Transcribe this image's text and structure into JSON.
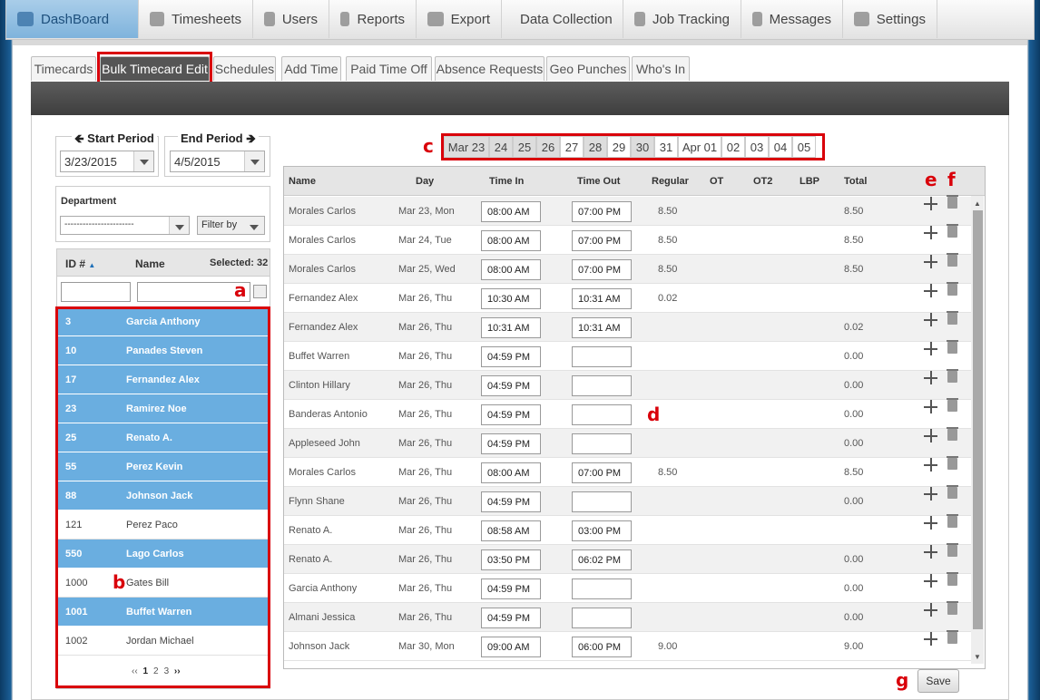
{
  "nav": {
    "items": [
      {
        "label": "DashBoard",
        "icon": "dashboard-gauge-icon",
        "active": true
      },
      {
        "label": "Timesheets",
        "icon": "calendar-icon",
        "active": false
      },
      {
        "label": "Users",
        "icon": "user-icon",
        "active": false
      },
      {
        "label": "Reports",
        "icon": "bar-chart-icon",
        "active": false
      },
      {
        "label": "Export",
        "icon": "export-arrow-icon",
        "active": false
      },
      {
        "label": "Data Collection",
        "icon": "data-collection-icon",
        "active": false
      },
      {
        "label": "Job Tracking",
        "icon": "job-tracking-icon",
        "active": false
      },
      {
        "label": "Messages",
        "icon": "chat-bubble-icon",
        "active": false
      },
      {
        "label": "Settings",
        "icon": "wrench-screwdriver-icon",
        "active": false
      }
    ]
  },
  "tabs": [
    "Timecards",
    "Bulk Timecard Edit",
    "Schedules",
    "Add Time",
    "Paid Time Off",
    "Absence Requests",
    "Geo Punches",
    "Who's In"
  ],
  "period": {
    "start_label": "Start Period",
    "start_value": "3/23/2015",
    "end_label": "End Period",
    "end_value": "4/5/2015"
  },
  "department": {
    "label": "Department",
    "value": "-----------------------",
    "filter_label": "Filter by"
  },
  "employee_list": {
    "headers": {
      "id": "ID #",
      "name": "Name",
      "selected": "Selected: 32"
    },
    "rows": [
      {
        "id": "3",
        "name": "Garcia Anthony",
        "selected": true
      },
      {
        "id": "10",
        "name": "Panades Steven",
        "selected": true
      },
      {
        "id": "17",
        "name": "Fernandez Alex",
        "selected": true
      },
      {
        "id": "23",
        "name": "Ramirez Noe",
        "selected": true
      },
      {
        "id": "25",
        "name": "Renato A.",
        "selected": true
      },
      {
        "id": "55",
        "name": "Perez Kevin",
        "selected": true
      },
      {
        "id": "88",
        "name": "Johnson Jack",
        "selected": true
      },
      {
        "id": "121",
        "name": "Perez Paco",
        "selected": false
      },
      {
        "id": "550",
        "name": "Lago Carlos",
        "selected": true
      },
      {
        "id": "1000",
        "name": "Gates Bill",
        "selected": false
      },
      {
        "id": "1001",
        "name": "Buffet Warren",
        "selected": true
      },
      {
        "id": "1002",
        "name": "Jordan Michael",
        "selected": false
      }
    ],
    "pager": {
      "prev": "‹‹",
      "pages": [
        "1",
        "2",
        "3"
      ],
      "current": "1",
      "next": "››"
    }
  },
  "dates": [
    {
      "label": "Mar 23",
      "shaded": true
    },
    {
      "label": "24",
      "shaded": true
    },
    {
      "label": "25",
      "shaded": true
    },
    {
      "label": "26",
      "shaded": true
    },
    {
      "label": "27",
      "shaded": false
    },
    {
      "label": "28",
      "shaded": true
    },
    {
      "label": "29",
      "shaded": false
    },
    {
      "label": "30",
      "shaded": true
    },
    {
      "label": "31",
      "shaded": false
    },
    {
      "label": "Apr 01",
      "shaded": false
    },
    {
      "label": "02",
      "shaded": false
    },
    {
      "label": "03",
      "shaded": false
    },
    {
      "label": "04",
      "shaded": false
    },
    {
      "label": "05",
      "shaded": false
    }
  ],
  "grid": {
    "headers": {
      "name": "Name",
      "day": "Day",
      "time_in": "Time In",
      "time_out": "Time Out",
      "regular": "Regular",
      "ot": "OT",
      "ot2": "OT2",
      "lbp": "LBP",
      "total": "Total"
    },
    "rows": [
      {
        "name": "Morales Carlos",
        "day": "Mar 23, Mon",
        "in": "08:00 AM",
        "out": "07:00 PM",
        "regular": "8.50",
        "total": "8.50"
      },
      {
        "name": "Morales Carlos",
        "day": "Mar 24, Tue",
        "in": "08:00 AM",
        "out": "07:00 PM",
        "regular": "8.50",
        "total": "8.50"
      },
      {
        "name": "Morales Carlos",
        "day": "Mar 25, Wed",
        "in": "08:00 AM",
        "out": "07:00 PM",
        "regular": "8.50",
        "total": "8.50"
      },
      {
        "name": "Fernandez Alex",
        "day": "Mar 26, Thu",
        "in": "10:30 AM",
        "out": "10:31 AM",
        "regular": "0.02",
        "total": ""
      },
      {
        "name": "Fernandez Alex",
        "day": "Mar 26, Thu",
        "in": "10:31 AM",
        "out": "10:31 AM",
        "regular": "",
        "total": "0.02"
      },
      {
        "name": "Buffet Warren",
        "day": "Mar 26, Thu",
        "in": "04:59 PM",
        "out": "",
        "regular": "",
        "total": "0.00"
      },
      {
        "name": "Clinton Hillary",
        "day": "Mar 26, Thu",
        "in": "04:59 PM",
        "out": "",
        "regular": "",
        "total": "0.00"
      },
      {
        "name": "Banderas Antonio",
        "day": "Mar 26, Thu",
        "in": "04:59 PM",
        "out": "",
        "regular": "",
        "total": "0.00"
      },
      {
        "name": "Appleseed John",
        "day": "Mar 26, Thu",
        "in": "04:59 PM",
        "out": "",
        "regular": "",
        "total": "0.00"
      },
      {
        "name": "Morales Carlos",
        "day": "Mar 26, Thu",
        "in": "08:00 AM",
        "out": "07:00 PM",
        "regular": "8.50",
        "total": "8.50"
      },
      {
        "name": "Flynn Shane",
        "day": "Mar 26, Thu",
        "in": "04:59 PM",
        "out": "",
        "regular": "",
        "total": "0.00"
      },
      {
        "name": "Renato A.",
        "day": "Mar 26, Thu",
        "in": "08:58 AM",
        "out": "03:00 PM",
        "regular": "",
        "total": ""
      },
      {
        "name": "Renato A.",
        "day": "Mar 26, Thu",
        "in": "03:50 PM",
        "out": "06:02 PM",
        "regular": "",
        "total": "0.00"
      },
      {
        "name": "Garcia Anthony",
        "day": "Mar 26, Thu",
        "in": "04:59 PM",
        "out": "",
        "regular": "",
        "total": "0.00"
      },
      {
        "name": "Almani Jessica",
        "day": "Mar 26, Thu",
        "in": "04:59 PM",
        "out": "",
        "regular": "",
        "total": "0.00"
      },
      {
        "name": "Johnson Jack",
        "day": "Mar 30, Mon",
        "in": "09:00 AM",
        "out": "06:00 PM",
        "regular": "9.00",
        "total": "9.00"
      }
    ]
  },
  "annotations": {
    "a": "a",
    "b": "b",
    "c": "c",
    "d": "d",
    "e": "e",
    "f": "f",
    "g": "g"
  },
  "save_label": "Save",
  "colors": {
    "accent": "#d9000a",
    "selected_row": "#6aaee0",
    "nav_active": "#8fbde2"
  }
}
